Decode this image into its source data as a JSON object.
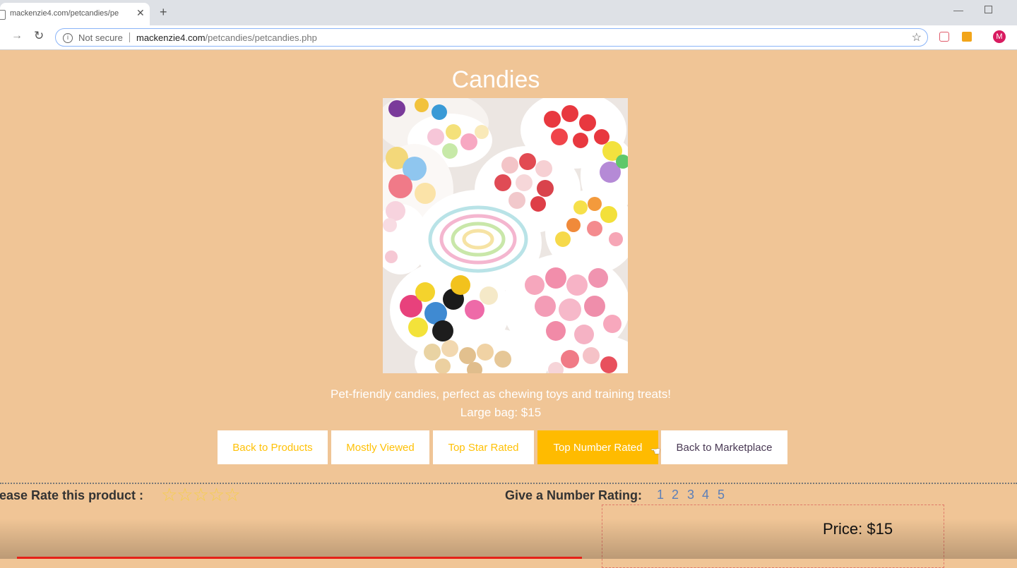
{
  "browser": {
    "tab_title": "mackenzie4.com/petcandies/pe",
    "new_tab": "+",
    "close": "✕",
    "security_label": "Not secure",
    "url_domain": "mackenzie4.com",
    "url_path": "/petcandies/petcandies.php",
    "avatar_letter": "M"
  },
  "product": {
    "title": "Candies",
    "description": "Pet-friendly candies, perfect as chewing toys and training treats!",
    "size_price": "Large bag: $15",
    "image_alt": "bowls of assorted candies"
  },
  "buttons": [
    {
      "label": "Back to Products"
    },
    {
      "label": "Mostly Viewed"
    },
    {
      "label": "Top Star Rated"
    },
    {
      "label": "Top Number Rated"
    },
    {
      "label": "Back to Marketplace"
    }
  ],
  "rating": {
    "star_label": "lease Rate this product :",
    "stars": "☆☆☆☆☆",
    "number_label": "Give a Number Rating:",
    "numbers": [
      "1",
      "2",
      "3",
      "4",
      "5"
    ]
  },
  "price": "Price: $15",
  "colors": {
    "background": "#f0c596",
    "button_text": "#ffc107",
    "active_button": "#ffbb00"
  }
}
